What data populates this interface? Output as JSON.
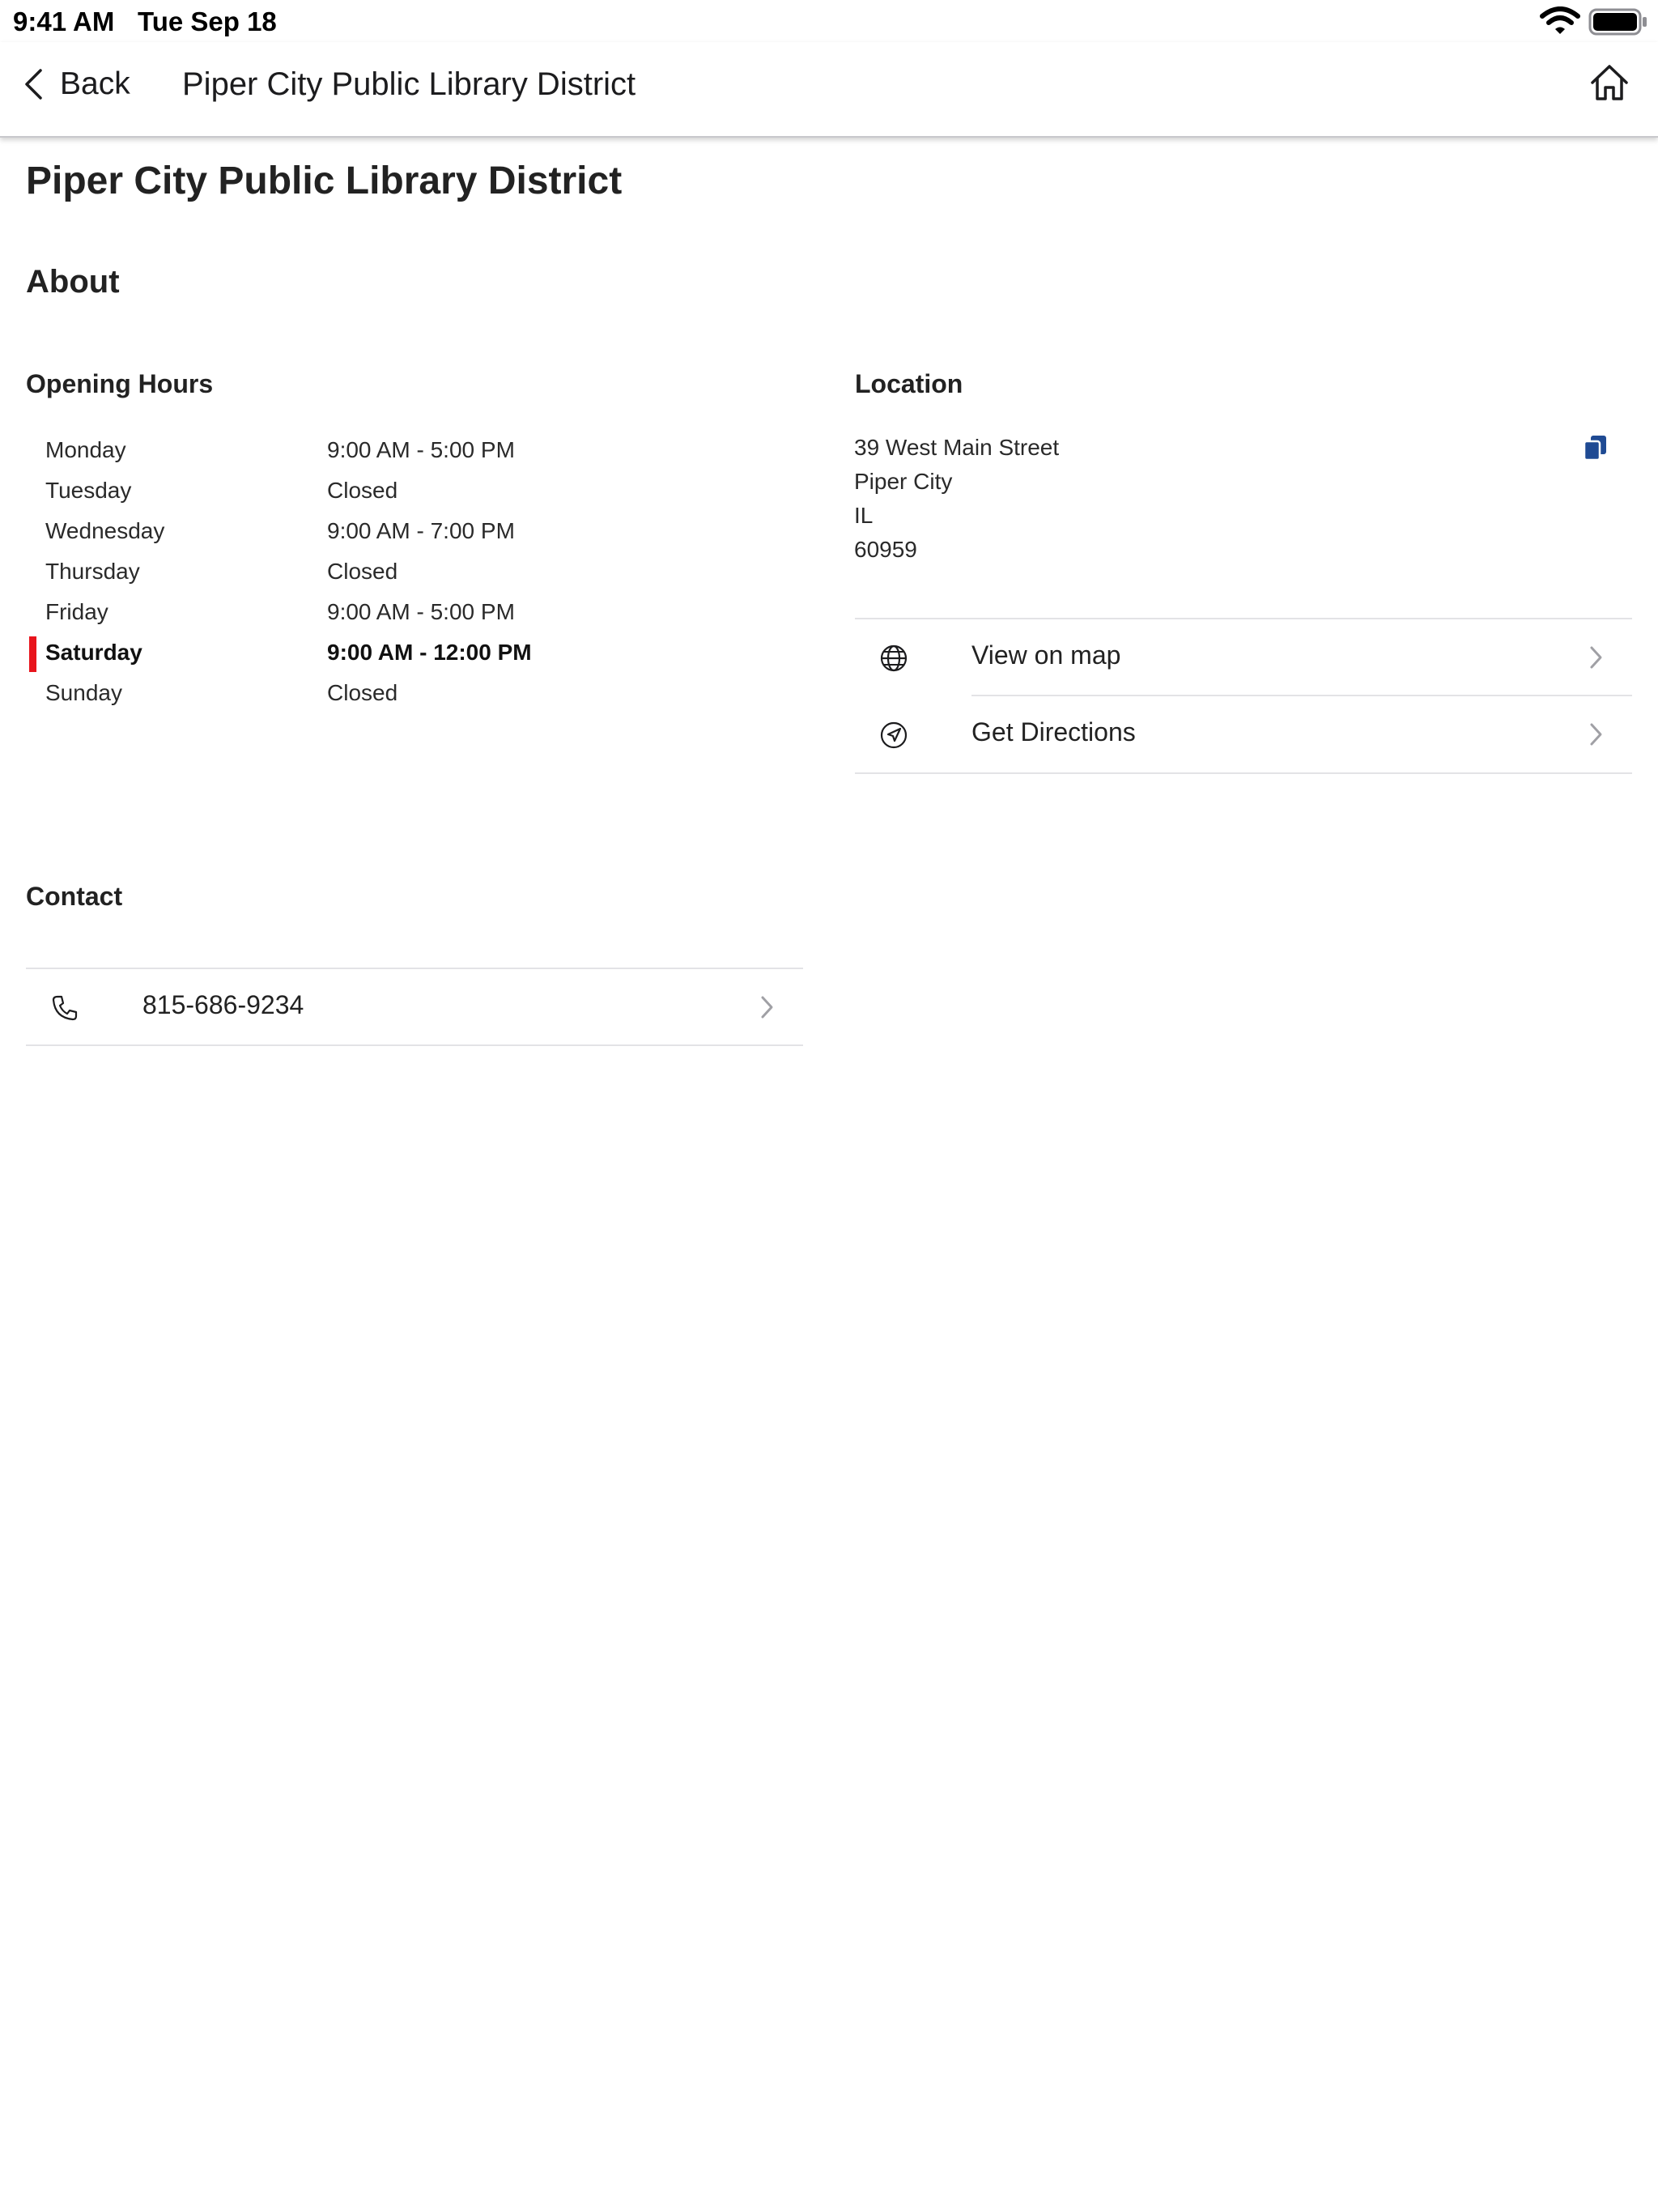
{
  "status_bar": {
    "time": "9:41 AM",
    "date": "Tue Sep 18",
    "icons": [
      "wifi-icon",
      "battery-icon"
    ]
  },
  "nav": {
    "back_label": "Back",
    "title": "Piper City Public Library District",
    "icons": [
      "chevron-left-icon",
      "home-icon"
    ]
  },
  "page": {
    "title": "Piper City Public Library District",
    "section_title": "About"
  },
  "opening_hours": {
    "heading": "Opening Hours",
    "days": [
      {
        "day": "Monday",
        "hours": "9:00 AM - 5:00 PM"
      },
      {
        "day": "Tuesday",
        "hours": "Closed"
      },
      {
        "day": "Wednesday",
        "hours": "9:00 AM - 7:00 PM"
      },
      {
        "day": "Thursday",
        "hours": "Closed"
      },
      {
        "day": "Friday",
        "hours": "9:00 AM - 5:00 PM"
      },
      {
        "day": "Saturday",
        "hours": "9:00 AM - 12:00 PM"
      },
      {
        "day": "Sunday",
        "hours": "Closed"
      }
    ],
    "current_day": "Saturday",
    "current_marker_color": "#e8141c"
  },
  "location": {
    "heading": "Location",
    "address_lines": [
      "39 West Main Street",
      "Piper City",
      "IL",
      "60959"
    ],
    "copy_icon": "copy-icon",
    "copy_icon_color": "#1f4a93",
    "actions": [
      {
        "label": "View on map",
        "icon": "globe-icon"
      },
      {
        "label": "Get Directions",
        "icon": "navigation-arrow-icon"
      }
    ]
  },
  "contact": {
    "heading": "Contact",
    "phone": "815-686-9234",
    "phone_icon": "phone-icon"
  }
}
